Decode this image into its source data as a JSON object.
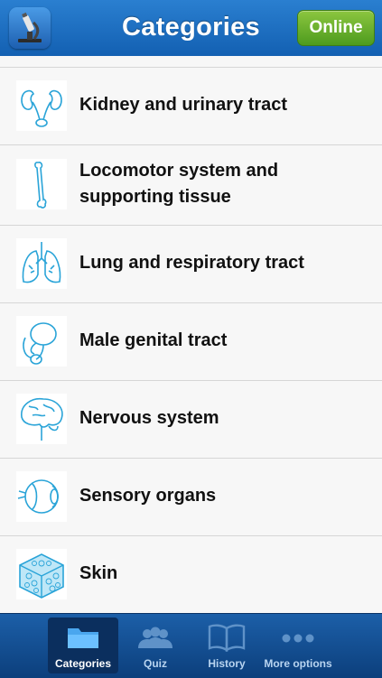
{
  "header": {
    "title": "Categories",
    "online_label": "Online",
    "app_icon": "microscope-icon"
  },
  "categories": [
    {
      "label": "Kidney and urinary tract",
      "icon": "kidney-icon"
    },
    {
      "label": "Locomotor system and supporting tissue",
      "icon": "bone-icon"
    },
    {
      "label": "Lung and respiratory tract",
      "icon": "lungs-icon"
    },
    {
      "label": "Male genital tract",
      "icon": "male-genital-icon"
    },
    {
      "label": "Nervous system",
      "icon": "brain-icon"
    },
    {
      "label": "Sensory organs",
      "icon": "eye-icon"
    },
    {
      "label": "Skin",
      "icon": "skin-icon"
    }
  ],
  "tabs": [
    {
      "label": "Categories",
      "icon": "folder-icon",
      "active": true
    },
    {
      "label": "Quiz",
      "icon": "people-icon",
      "active": false
    },
    {
      "label": "History",
      "icon": "book-icon",
      "active": false
    },
    {
      "label": "More options",
      "icon": "more-icon",
      "active": false
    }
  ],
  "colors": {
    "navbar": "#1a6cc0",
    "online": "#6cb22e",
    "tabbar": "#134d92",
    "icon_line": "#2aa4d8"
  }
}
